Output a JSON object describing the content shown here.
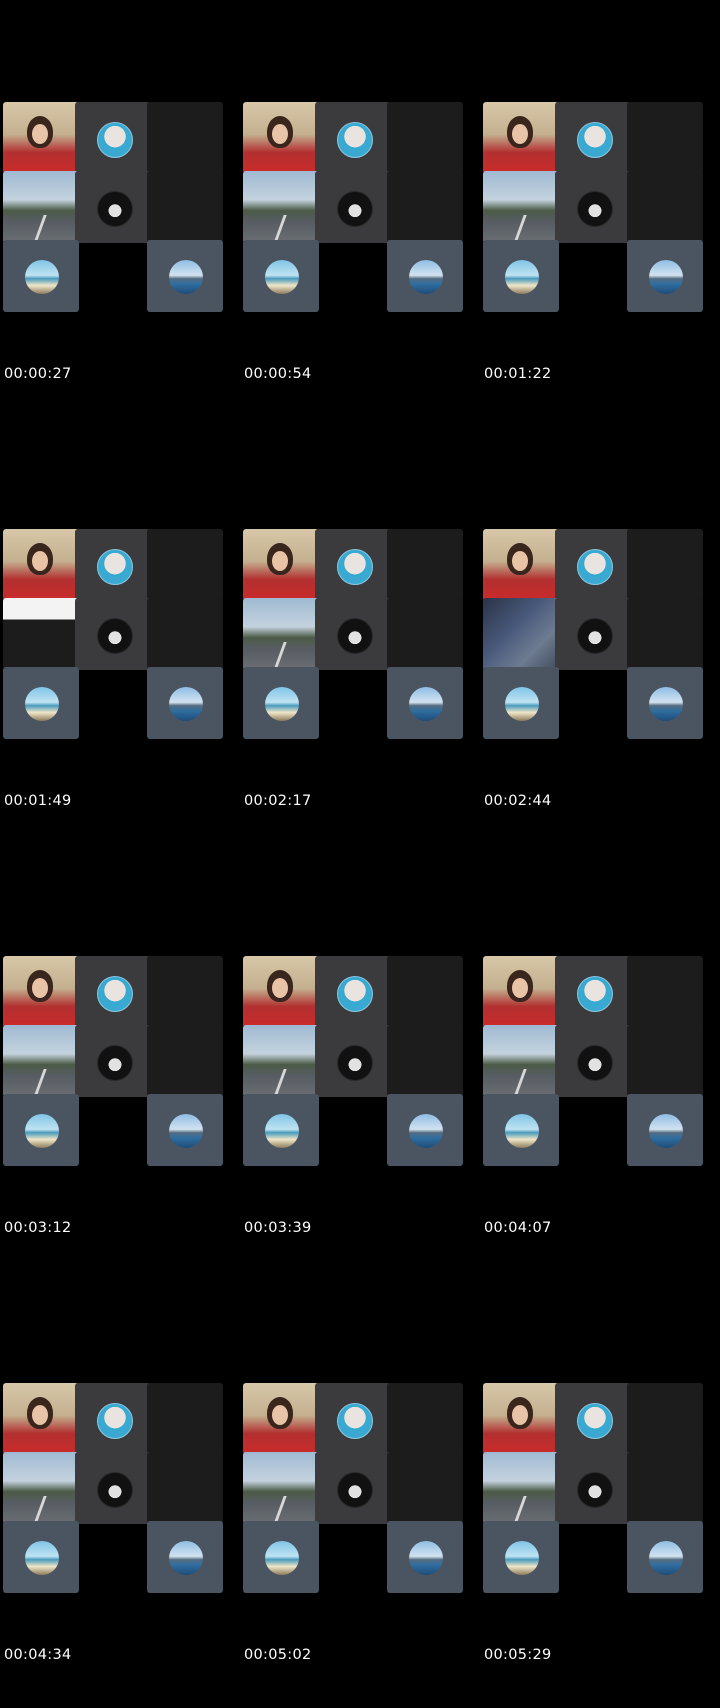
{
  "frames": [
    {
      "time": "00:00:27",
      "road_tile": "road"
    },
    {
      "time": "00:00:54",
      "road_tile": "road"
    },
    {
      "time": "00:01:22",
      "road_tile": "road"
    },
    {
      "time": "00:01:49",
      "road_tile": "chat"
    },
    {
      "time": "00:02:17",
      "road_tile": "road"
    },
    {
      "time": "00:02:44",
      "road_tile": "dark"
    },
    {
      "time": "00:03:12",
      "road_tile": "road"
    },
    {
      "time": "00:03:39",
      "road_tile": "road"
    },
    {
      "time": "00:04:07",
      "road_tile": "road"
    },
    {
      "time": "00:04:34",
      "road_tile": "road"
    },
    {
      "time": "00:05:02",
      "road_tile": "road"
    },
    {
      "time": "00:05:29",
      "road_tile": "road"
    }
  ],
  "colors": {
    "background": "#000000",
    "empty_tile": "#1c1c1c",
    "avatar_tile": "#3b3b3d",
    "slate_tile": "#4a5561"
  },
  "icons": {
    "face_avatar": "person-avatar-icon",
    "logo_avatar": "logo-avatar-icon",
    "pier_avatar": "pier-avatar-icon",
    "city_avatar": "city-avatar-icon"
  }
}
